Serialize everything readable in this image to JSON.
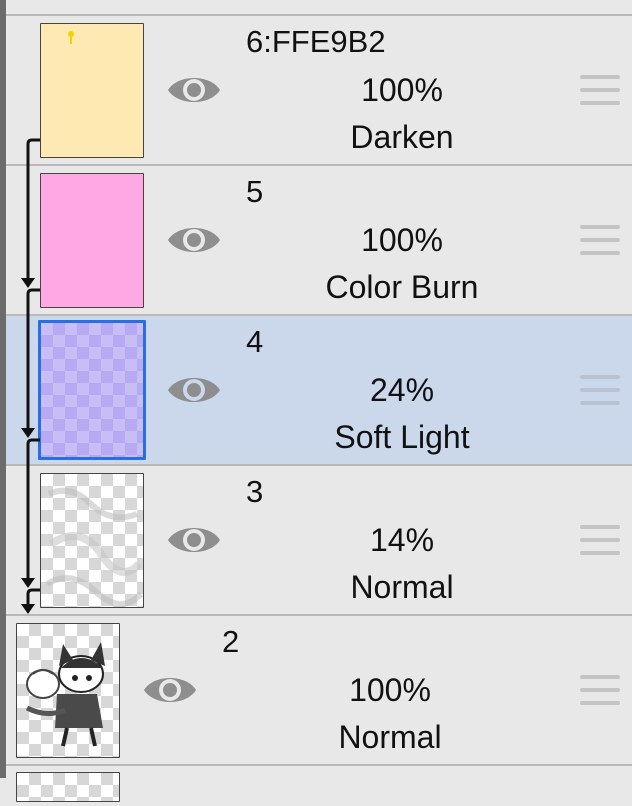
{
  "layers_panel": {
    "layers": [
      {
        "name": "",
        "opacity": "",
        "blend_mode": "",
        "thumbnail": "partial-previous-layer"
      },
      {
        "name": "6:FFE9B2",
        "opacity": "100%",
        "blend_mode": "Darken",
        "thumbnail_color": "#FFE9B2",
        "clipped": true,
        "selected": false
      },
      {
        "name": "5",
        "opacity": "100%",
        "blend_mode": "Color Burn",
        "thumbnail_color": "#FFA8E4",
        "clipped": true,
        "selected": false
      },
      {
        "name": "4",
        "opacity": "24%",
        "blend_mode": "Soft Light",
        "thumbnail_color": "#C9BDF6",
        "clipped": true,
        "selected": true
      },
      {
        "name": "3",
        "opacity": "14%",
        "blend_mode": "Normal",
        "thumbnail_color": "#FFFFFF",
        "clipped": true,
        "selected": false
      },
      {
        "name": "2",
        "opacity": "100%",
        "blend_mode": "Normal",
        "thumbnail": "character-sketch",
        "clipped": false,
        "selected": false
      }
    ],
    "icons": {
      "visibility": "eye-icon",
      "reorder": "drag-handle-icon",
      "clipping": "clipping-arrow-icon"
    },
    "colors": {
      "panel_bg": "#E8E8E8",
      "selected_row_bg": "#CBD8EC",
      "selected_border": "#2A6FE0",
      "icon_gray": "#8E8E8E"
    }
  }
}
